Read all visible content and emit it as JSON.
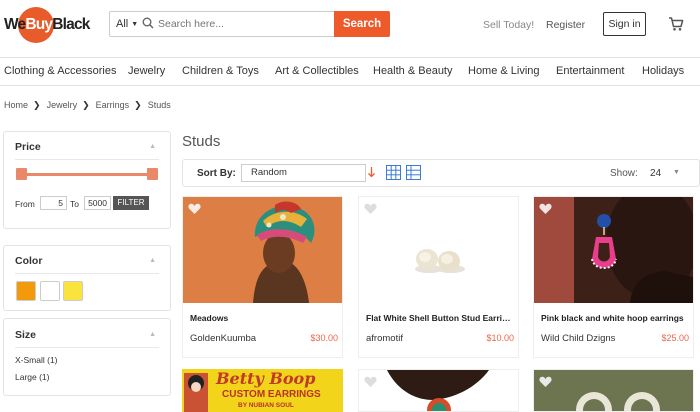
{
  "header": {
    "logo": {
      "we": "We",
      "buy": "Buy",
      "black": "Black"
    },
    "search": {
      "scope": "All",
      "placeholder": "Search here...",
      "button": "Search"
    },
    "sell_today": "Sell Today!",
    "register": "Register",
    "signin": "Sign in",
    "cart_icon": "cart-icon"
  },
  "categories": [
    "Clothing & Accessories",
    "Jewelry",
    "Children & Toys",
    "Art & Collectibles",
    "Health & Beauty",
    "Home & Living",
    "Entertainment",
    "Holidays"
  ],
  "breadcrumb": [
    "Home",
    "Jewelry",
    "Earrings",
    "Studs"
  ],
  "sidebar": {
    "price": {
      "title": "Price",
      "from_label": "From",
      "from": "5",
      "to_label": "To",
      "to": "5000",
      "filter": "FILTER"
    },
    "color": {
      "title": "Color",
      "swatches": [
        "#f39a0c",
        "#ffffff",
        "#f9e33c"
      ]
    },
    "size": {
      "title": "Size",
      "items": [
        "X-Small (1)",
        "Large (1)"
      ]
    }
  },
  "main": {
    "title": "Studs",
    "sort_label": "Sort By:",
    "sort_value": "Random",
    "show_label": "Show:",
    "show_value": "24"
  },
  "products": [
    {
      "name": "Meadows",
      "seller": "GoldenKuumba",
      "price": "$30.00"
    },
    {
      "name": "Flat White Shell Button Stud Earrings",
      "seller": "afromotif",
      "price": "$10.00"
    },
    {
      "name": "Pink black and white hoop earrings",
      "seller": "Wild Child Dzigns",
      "price": "$25.00"
    }
  ],
  "row2": {
    "text1": "Betty Boop",
    "text2": "CUSTOM EARRINGS",
    "text3": "BY NUBIAN SOUL"
  },
  "accent": "#ef5a2b"
}
